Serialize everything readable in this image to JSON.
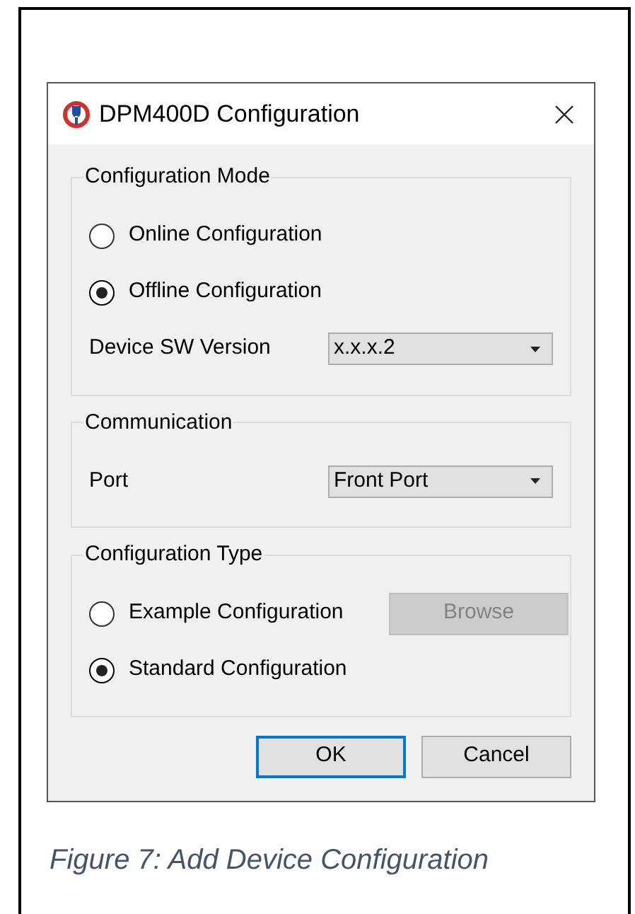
{
  "window": {
    "title": "DPM400D Configuration"
  },
  "groups": [
    {
      "title": "Configuration Mode",
      "rows": [
        {
          "kind": "radio",
          "label": "Online Configuration",
          "selected": false
        },
        {
          "kind": "radio",
          "label": "Offline Configuration",
          "selected": true
        },
        {
          "kind": "select",
          "label": "Device SW Version",
          "value": "x.x.x.2"
        }
      ]
    },
    {
      "title": "Communication",
      "rows": [
        {
          "kind": "select",
          "label": "Port",
          "value": "Front Port"
        }
      ]
    },
    {
      "title": "Configuration Type",
      "rows": [
        {
          "kind": "radio",
          "label": "Example Configuration",
          "selected": false,
          "button": {
            "label": "Browse",
            "disabled": true
          }
        },
        {
          "kind": "radio",
          "label": "Standard Configuration",
          "selected": true
        }
      ]
    }
  ],
  "buttons": [
    {
      "label": "OK",
      "default": true
    },
    {
      "label": "Cancel",
      "default": false
    }
  ],
  "caption": "Figure 7: Add Device Configuration"
}
